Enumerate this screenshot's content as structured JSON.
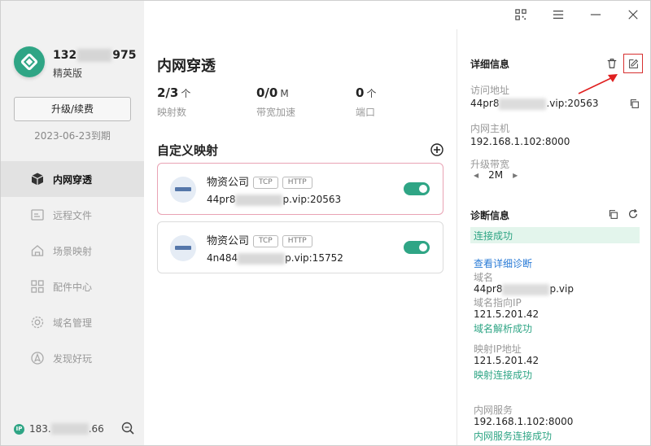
{
  "user": {
    "id_prefix": "132",
    "id_suffix": "975",
    "plan": "精英版",
    "upgrade_label": "升级/续费",
    "expire": "2023-06-23到期"
  },
  "sidebar": {
    "items": [
      {
        "label": "内网穿透",
        "icon": "cube-icon",
        "active": true
      },
      {
        "label": "远程文件",
        "icon": "folder-icon",
        "active": false
      },
      {
        "label": "场景映射",
        "icon": "home-icon",
        "active": false
      },
      {
        "label": "配件中心",
        "icon": "grid-icon",
        "active": false
      },
      {
        "label": "域名管理",
        "icon": "gear-icon",
        "active": false
      },
      {
        "label": "发现好玩",
        "icon": "compass-icon",
        "active": false
      }
    ],
    "ip_prefix": "183.",
    "ip_suffix": ".66"
  },
  "main": {
    "title": "内网穿透",
    "stats": [
      {
        "value": "2/3",
        "unit": "个",
        "label": "映射数"
      },
      {
        "value": "0/0",
        "unit": "M",
        "label": "带宽加速"
      },
      {
        "value": "0",
        "unit": "个",
        "label": "端口"
      }
    ],
    "section_title": "自定义映射",
    "mappings": [
      {
        "name": "物资公司",
        "tags": [
          "TCP",
          "HTTP"
        ],
        "addr_prefix": "44pr8",
        "addr_suffix": "p.vip:20563"
      },
      {
        "name": "物资公司",
        "tags": [
          "TCP",
          "HTTP"
        ],
        "addr_prefix": "4n484",
        "addr_suffix": "p.vip:15752"
      }
    ]
  },
  "detail": {
    "title": "详细信息",
    "visit_label": "访问地址",
    "visit_prefix": "44pr8",
    "visit_suffix": ".vip:20563",
    "host_label": "内网主机",
    "host_value": "192.168.1.102:8000",
    "bandwidth_label": "升级带宽",
    "bandwidth_value": "2M"
  },
  "diagnosis": {
    "title": "诊断信息",
    "status": "连接成功",
    "view_detail": "查看详细诊断",
    "domain_label": "域名",
    "domain_prefix": "44pr8",
    "domain_suffix": "p.vip",
    "domain_ip_label": "域名指向IP",
    "domain_ip_value": "121.5.201.42",
    "domain_ip_status": "域名解析成功",
    "map_ip_label": "映射IP地址",
    "map_ip_value": "121.5.201.42",
    "map_ip_status": "映射连接成功",
    "service_label": "内网服务",
    "service_value": "192.168.1.102:8000",
    "service_status": "内网服务连接成功"
  },
  "colors": {
    "accent": "#2fa585",
    "link": "#2a7bd6",
    "highlight": "#d73030"
  }
}
